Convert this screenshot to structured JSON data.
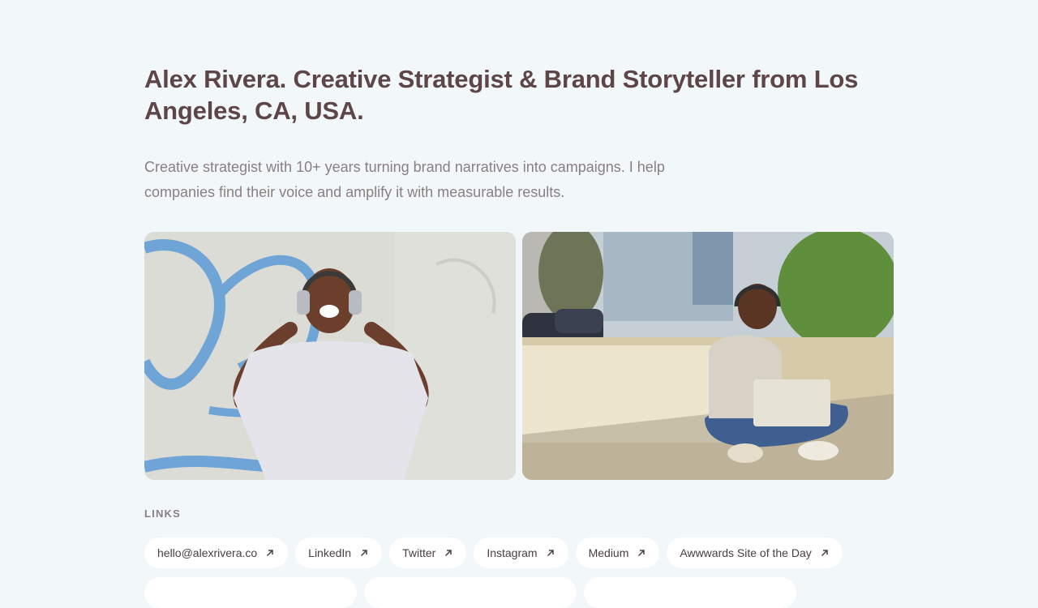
{
  "profile": {
    "headline": "Alex Rivera. Creative Strategist & Brand Storyteller from Los Angeles, CA, USA.",
    "intro": "Creative strategist with 10+ years turning brand narratives into campaigns. I help companies find their voice and amplify it with measurable results."
  },
  "photos": [
    {
      "name": "photo-woman-headphones-wall"
    },
    {
      "name": "photo-woman-laptop-street"
    }
  ],
  "links_section": {
    "title": "LINKS",
    "items": [
      {
        "label": "hello@alexrivera.co",
        "icon": "arrow-up-right-icon"
      },
      {
        "label": "LinkedIn",
        "icon": "arrow-up-right-icon"
      },
      {
        "label": "Twitter",
        "icon": "arrow-up-right-icon"
      },
      {
        "label": "Instagram",
        "icon": "arrow-up-right-icon"
      },
      {
        "label": "Medium",
        "icon": "arrow-up-right-icon"
      },
      {
        "label": "Awwwards Site of the Day",
        "icon": "arrow-up-right-icon"
      }
    ]
  },
  "colors": {
    "background": "#f2f8fa",
    "headline": "#5e4648",
    "body_text": "#8a7f80",
    "pill_background": "#ffffff"
  }
}
